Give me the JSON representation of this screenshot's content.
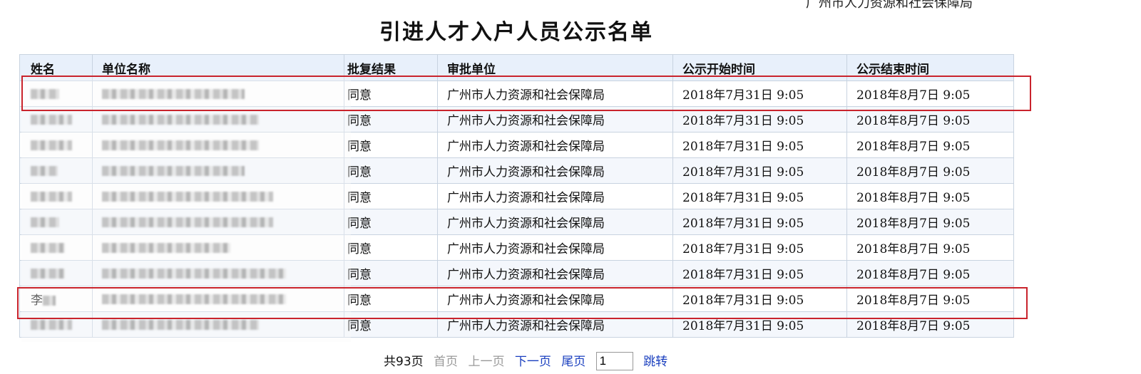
{
  "header": {
    "agency": "广州市人力资源和社会保障局",
    "title": "引进人才入户人员公示名单"
  },
  "table": {
    "columns": [
      "姓名",
      "单位名称",
      "批复结果",
      "审批单位",
      "公示开始时间",
      "公示结束时间"
    ],
    "rows": [
      {
        "name": "",
        "unit": "",
        "result": "同意",
        "authority": "广州市人力资源和社会保障局",
        "start": "2018年7月31日  9:05",
        "end": "2018年8月7日  9:05"
      },
      {
        "name": "",
        "unit": "",
        "result": "同意",
        "authority": "广州市人力资源和社会保障局",
        "start": "2018年7月31日  9:05",
        "end": "2018年8月7日  9:05"
      },
      {
        "name": "",
        "unit": "",
        "result": "同意",
        "authority": "广州市人力资源和社会保障局",
        "start": "2018年7月31日  9:05",
        "end": "2018年8月7日  9:05"
      },
      {
        "name": "",
        "unit": "",
        "result": "同意",
        "authority": "广州市人力资源和社会保障局",
        "start": "2018年7月31日  9:05",
        "end": "2018年8月7日  9:05"
      },
      {
        "name": "",
        "unit": "",
        "result": "同意",
        "authority": "广州市人力资源和社会保障局",
        "start": "2018年7月31日  9:05",
        "end": "2018年8月7日  9:05"
      },
      {
        "name": "",
        "unit": "",
        "result": "同意",
        "authority": "广州市人力资源和社会保障局",
        "start": "2018年7月31日  9:05",
        "end": "2018年8月7日  9:05"
      },
      {
        "name": "",
        "unit": "",
        "result": "同意",
        "authority": "广州市人力资源和社会保障局",
        "start": "2018年7月31日  9:05",
        "end": "2018年8月7日  9:05"
      },
      {
        "name": "",
        "unit": "",
        "result": "同意",
        "authority": "广州市人力资源和社会保障局",
        "start": "2018年7月31日  9:05",
        "end": "2018年8月7日  9:05"
      },
      {
        "name": "李",
        "unit": "",
        "result": "同意",
        "authority": "广州市人力资源和社会保障局",
        "start": "2018年7月31日  9:05",
        "end": "2018年8月7日  9:05"
      },
      {
        "name": "",
        "unit": "",
        "result": "同意",
        "authority": "广州市人力资源和社会保障局",
        "start": "2018年7月31日  9:05",
        "end": "2018年8月7日  9:05"
      }
    ]
  },
  "pager": {
    "total": "共93页",
    "first": "首页",
    "prev": "上一页",
    "next": "下一页",
    "last": "尾页",
    "page_input_value": "1",
    "jump": "跳转"
  },
  "colors": {
    "header_bg": "#e8f0fb",
    "border": "#c8d3e0",
    "highlight": "#c9232c",
    "link": "#1a3fbf"
  }
}
